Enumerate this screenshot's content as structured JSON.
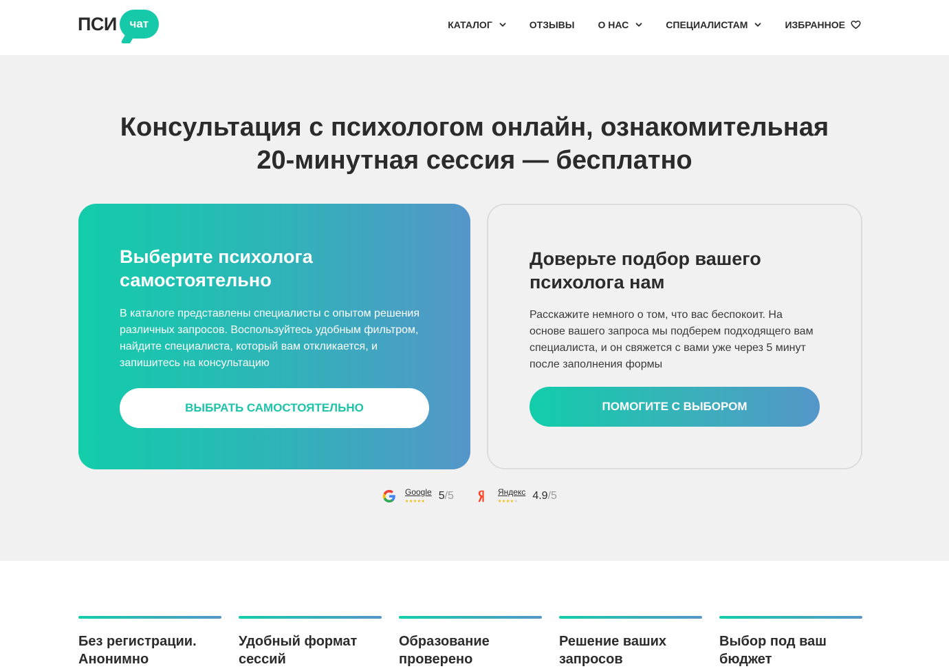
{
  "header": {
    "logo_text": "ПСИ",
    "logo_bubble": "чат",
    "nav": [
      {
        "label": "КАТАЛОГ",
        "dropdown": true
      },
      {
        "label": "ОТЗЫВЫ",
        "dropdown": false
      },
      {
        "label": "О НАС",
        "dropdown": true
      },
      {
        "label": "СПЕЦИАЛИСТАМ",
        "dropdown": true
      },
      {
        "label": "ИЗБРАННОЕ",
        "icon": "heart-icon"
      }
    ]
  },
  "hero": {
    "title_line1": "Консультация с психологом онлайн, ознакомительная",
    "title_line2": "20-минутная сессия — бесплатно",
    "card_self": {
      "title": "Выберите психолога самостоятельно",
      "text": "В каталоге представлены специалисты с опытом решения различных запросов. Воспользуйтесь удобным фильтром, найдите специалиста, который вам откликается, и запишитесь на консультацию",
      "button": "ВЫБРАТЬ САМОСТОЯТЕЛЬНО"
    },
    "card_help": {
      "title": "Доверьте подбор вашего психолога нам",
      "text": "Расскажите немного о том, что вас беспокоит. На основе вашего запроса мы подберем подходящего вам специалиста, и он свяжется с вами уже через 5 минут после заполнения формы",
      "button": "ПОМОГИТЕ С ВЫБОРОМ"
    },
    "ratings": [
      {
        "name": "Google",
        "score": "5",
        "max": "/5",
        "icon": "google-icon",
        "stars_value": 5
      },
      {
        "name": "Яндекс",
        "score": "4.9",
        "max": "/5",
        "icon": "yandex-icon",
        "stars_value": 4.9
      }
    ]
  },
  "features": [
    {
      "title": "Без регистрации. Анонимно"
    },
    {
      "title": "Удобный формат сессий"
    },
    {
      "title": "Образование проверено"
    },
    {
      "title": "Решение ваших запросов"
    },
    {
      "title": "Выбор под ваш бюджет"
    }
  ],
  "colors": {
    "accent_green": "#12cdaa",
    "accent_blue": "#5496c9",
    "text_dark": "#2b2b2b",
    "hero_bg": "#f1f1f1"
  }
}
